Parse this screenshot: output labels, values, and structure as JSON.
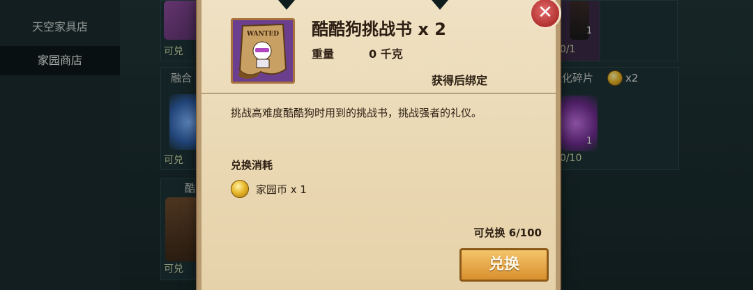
{
  "sidebar": {
    "items": [
      {
        "label": "天空家具店"
      },
      {
        "label": "家园商店"
      }
    ]
  },
  "background_cards": {
    "left_top_status": "可兑",
    "left_mid_label": "融合",
    "left_mid_status": "可兑",
    "left_bottom_label": "酷",
    "left_bottom_status": "可兑",
    "right_top_count": "1",
    "right_top_status": "0/1",
    "right_mid_label": "进化碎片",
    "right_mid_price": "x2",
    "right_mid_count": "1",
    "right_mid_status": "0/10"
  },
  "dialog": {
    "wanted_text": "WANTED",
    "title": "酷酷狗挑战书 x 2",
    "weight_label": "重量",
    "weight_value": "0 千克",
    "bind_text": "获得后绑定",
    "description": "挑战高难度酷酷狗时用到的挑战书，挑战强者的礼仪。",
    "cost_title": "兑换消耗",
    "cost_item": "家园币 x 1",
    "stock": "可兑换 6/100",
    "exchange_button": "兑换",
    "close_symbol": "✕"
  },
  "colors": {
    "parchment": "#ecdcb8",
    "button_orange": "#e6a443",
    "close_red": "#c4403f",
    "item_purple": "#6b3f8e"
  },
  "icons": [
    "wanted-poster-icon",
    "home-coin-icon",
    "close-icon"
  ]
}
